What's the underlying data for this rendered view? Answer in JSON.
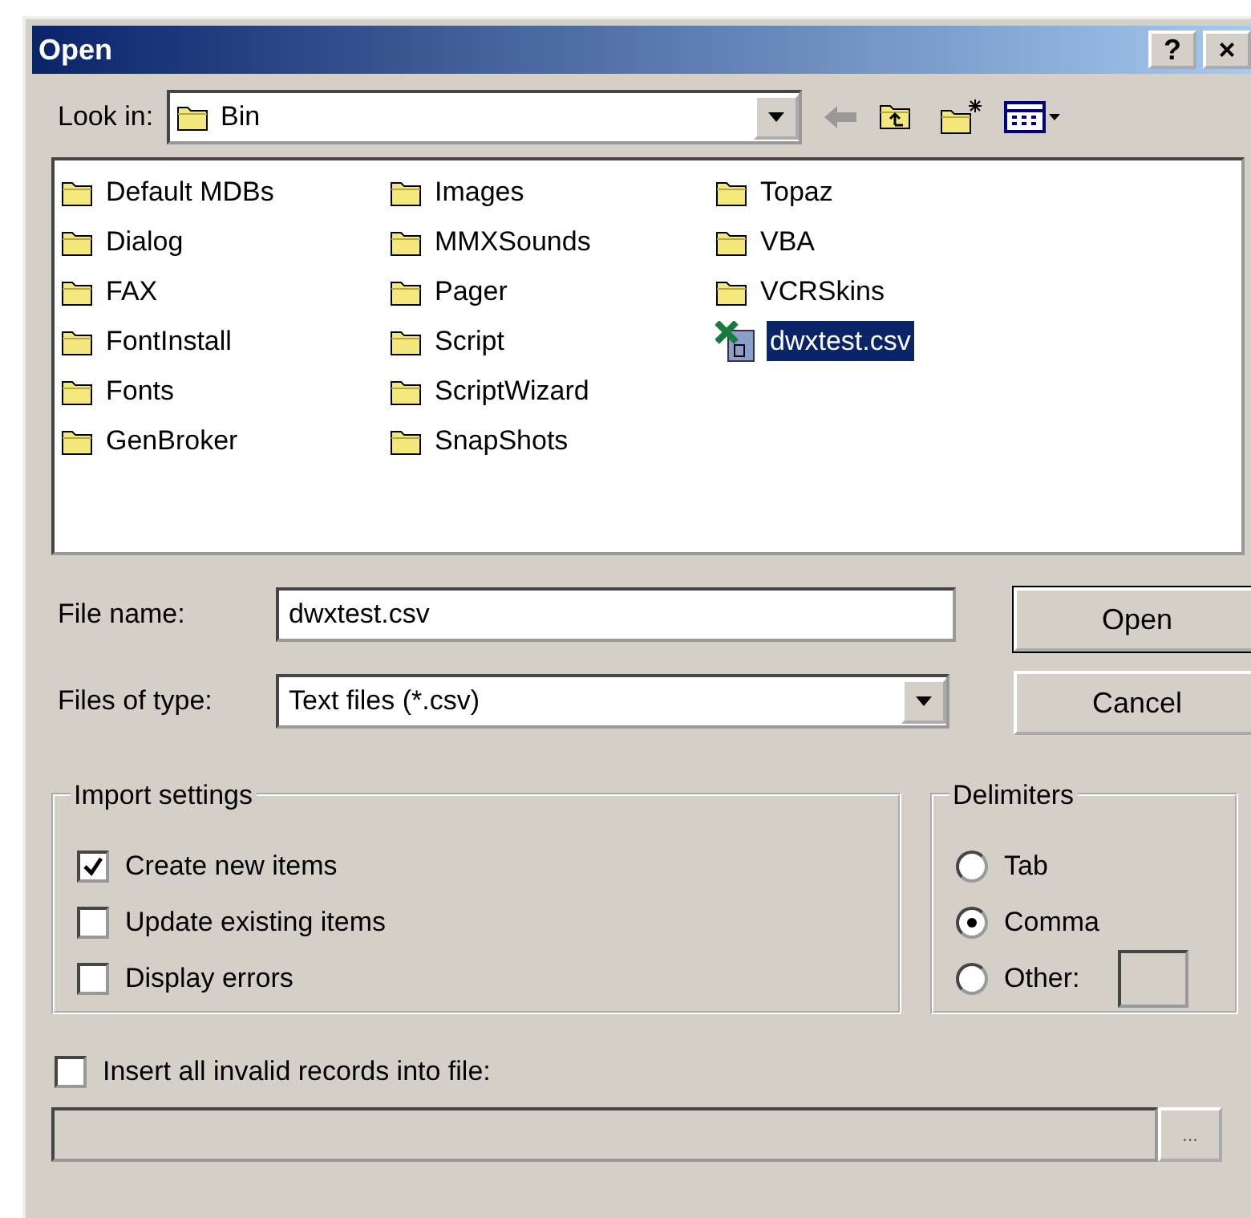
{
  "window": {
    "title": "Open",
    "title_buttons": [
      "?",
      "×"
    ]
  },
  "look_in": {
    "label": "Look in:",
    "value": "Bin"
  },
  "files": [
    {
      "name": "Default MDBs",
      "kind": "folder",
      "selected": false
    },
    {
      "name": "Dialog",
      "kind": "folder",
      "selected": false
    },
    {
      "name": "FAX",
      "kind": "folder",
      "selected": false
    },
    {
      "name": "FontInstall",
      "kind": "folder",
      "selected": false
    },
    {
      "name": "Fonts",
      "kind": "folder",
      "selected": false
    },
    {
      "name": "GenBroker",
      "kind": "folder",
      "selected": false
    },
    {
      "name": "Images",
      "kind": "folder",
      "selected": false
    },
    {
      "name": "MMXSounds",
      "kind": "folder",
      "selected": false
    },
    {
      "name": "Pager",
      "kind": "folder",
      "selected": false
    },
    {
      "name": "Script",
      "kind": "folder",
      "selected": false
    },
    {
      "name": "ScriptWizard",
      "kind": "folder",
      "selected": false
    },
    {
      "name": "SnapShots",
      "kind": "folder",
      "selected": false
    },
    {
      "name": "Topaz",
      "kind": "folder",
      "selected": false
    },
    {
      "name": "VBA",
      "kind": "folder",
      "selected": false
    },
    {
      "name": "VCRSkins",
      "kind": "folder",
      "selected": false
    },
    {
      "name": "dwxtest.csv",
      "kind": "csv",
      "selected": true
    }
  ],
  "file_name": {
    "label": "File name:",
    "value": "dwxtest.csv"
  },
  "files_of_type": {
    "label": "Files of type:",
    "value": "Text files (*.csv)"
  },
  "buttons": [
    {
      "label": "Open",
      "default": true
    },
    {
      "label": "Cancel",
      "default": false
    }
  ],
  "import_settings": {
    "title": "Import settings",
    "options": [
      {
        "label": "Create new items",
        "checked": true
      },
      {
        "label": "Update existing items",
        "checked": false
      },
      {
        "label": "Display errors",
        "checked": false
      }
    ]
  },
  "delimiters": {
    "title": "Delimiters",
    "options": [
      {
        "label": "Tab",
        "kind": "plain",
        "selected": false
      },
      {
        "label": "Comma",
        "kind": "plain",
        "selected": true
      },
      {
        "label": "Other:",
        "kind": "with_field",
        "selected": false
      }
    ]
  },
  "insert_invalid": {
    "label": "Insert all invalid records into file:",
    "checked": false
  },
  "browse_button": {
    "label": "..."
  }
}
